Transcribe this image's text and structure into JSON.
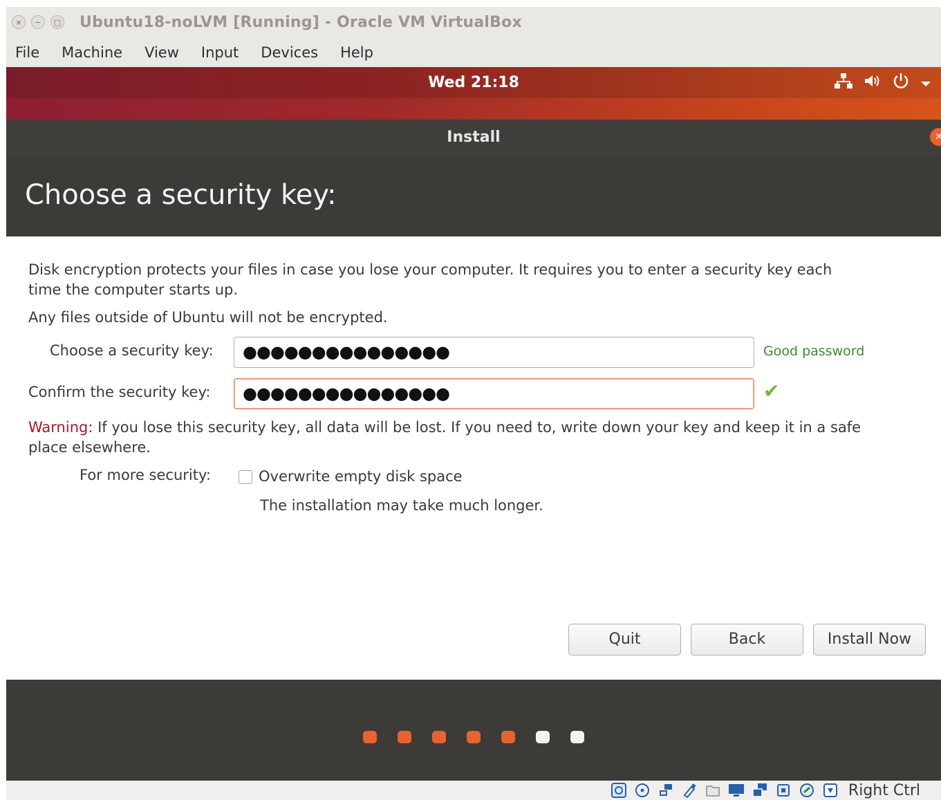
{
  "host": {
    "window_title": "Ubuntu18-noLVM [Running] - Oracle VM VirtualBox",
    "window_buttons": [
      "×",
      "−",
      "□"
    ],
    "menu": [
      "File",
      "Machine",
      "View",
      "Input",
      "Devices",
      "Help"
    ],
    "status_icons": [
      "hard-disk-icon",
      "optical-drive-icon",
      "network-icon",
      "usb-icon",
      "shared-folder-icon",
      "display-icon",
      "video-capture-icon",
      "cpu-icon",
      "mouse-integration-icon",
      "keyboard-icon"
    ],
    "host_key": "Right Ctrl"
  },
  "guest": {
    "clock": "Wed 21:18",
    "tray": [
      "network-icon",
      "volume-icon",
      "power-icon",
      "chevron-down-icon"
    ]
  },
  "installer": {
    "title": "Install",
    "heading": "Choose a security key:",
    "description_1": "Disk encryption protects your files in case you lose your computer. It requires you to enter a security key each",
    "description_1b": "time the computer starts up.",
    "description_2": "Any files outside of Ubuntu will not be encrypted.",
    "key_label": "Choose a security key:",
    "key_value": "●●●●●●●●●●●●●●●",
    "strength": "Good password",
    "confirm_label": "Confirm the security key:",
    "confirm_value": "●●●●●●●●●●●●●●●",
    "warning_prefix": "Warning:",
    "warning_text_1": " If you lose this security key, all data will be lost. If you need to, write down your key and keep it in a safe",
    "warning_text_2": "place elsewhere.",
    "more_security_label": "For more security:",
    "overwrite_label": "Overwrite empty disk space",
    "overwrite_checked": false,
    "overwrite_note": "The installation may take much longer.",
    "buttons": {
      "quit": "Quit",
      "back": "Back",
      "install_now": "Install Now"
    },
    "progress": {
      "completed_steps": 5,
      "total_steps": 7
    },
    "accent_color": "#e9622f"
  }
}
